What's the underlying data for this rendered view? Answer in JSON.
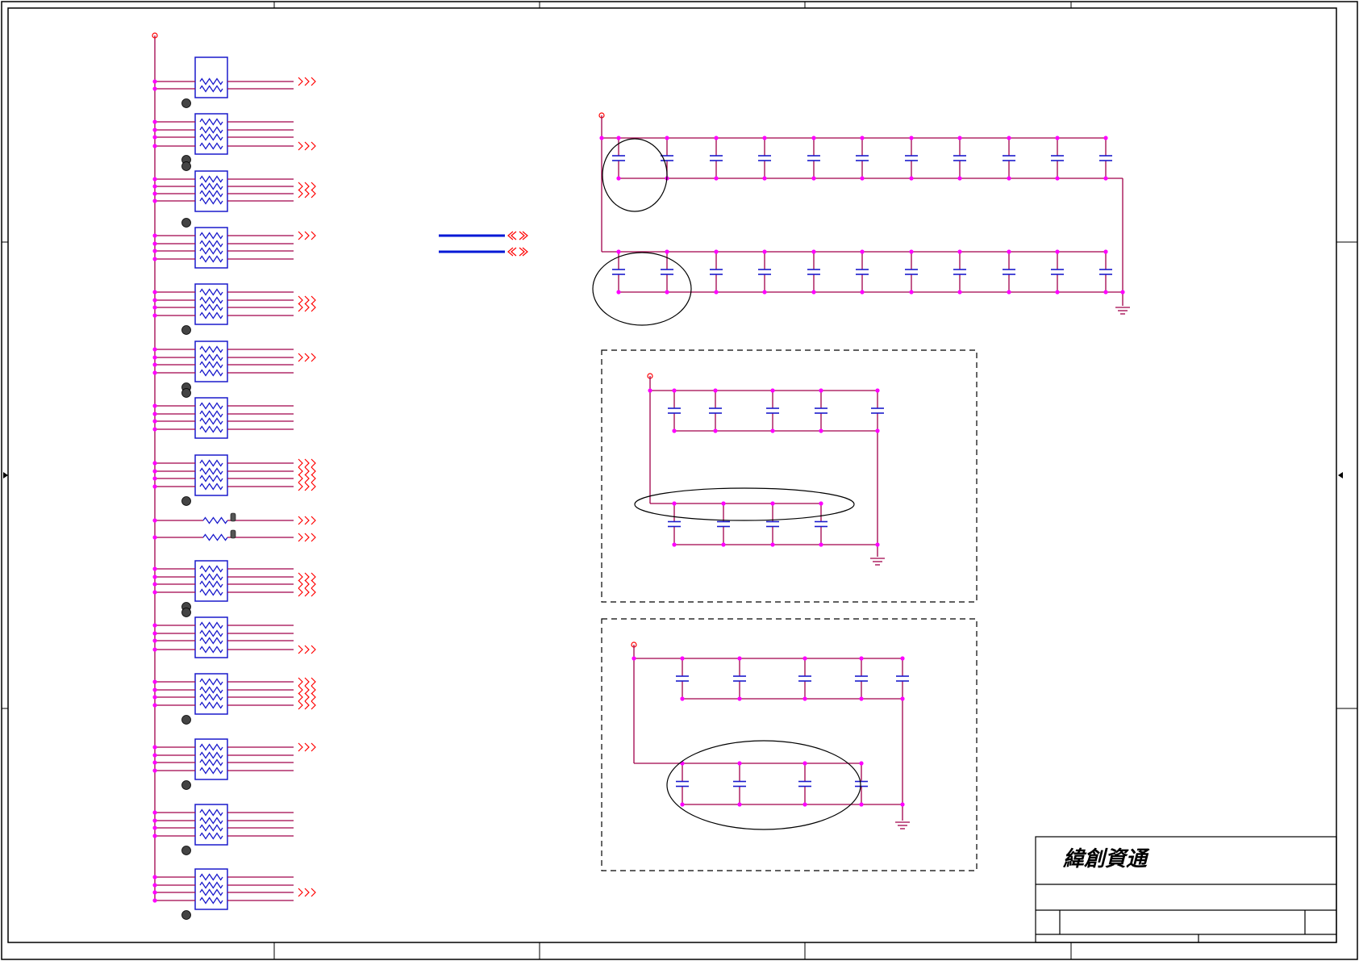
{
  "title_block": {
    "company": "緯創資通"
  },
  "colors": {
    "wire": "#a0004a",
    "net": "#ff00ff",
    "component": "#1a1acc",
    "offpage": "#ff0000",
    "border": "#000000",
    "bus": "#0018d6"
  },
  "icons": {
    "resistor_network": "resistor-array-icon",
    "capacitor": "capacitor-icon",
    "ground": "ground-icon",
    "power_port": "power-port-icon",
    "offpage_connector": "offpage-arrow-icon"
  }
}
